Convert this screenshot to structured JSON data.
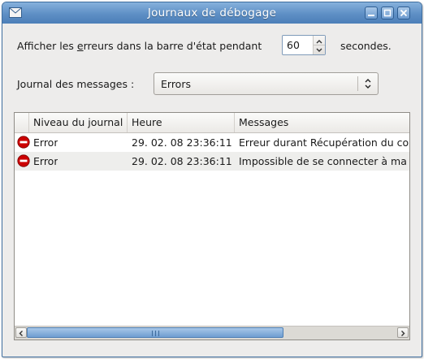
{
  "window": {
    "title": "Journaux de débogage",
    "icon": "envelope-icon"
  },
  "status_row": {
    "label_prefix": "Afficher les ",
    "label_mnemonic": "e",
    "label_suffix": "rreurs dans la barre d'état pendant",
    "seconds_value": "60",
    "unit_label": "secondes."
  },
  "filter": {
    "label": "Journal des messages :",
    "selected": "Errors"
  },
  "log_table": {
    "columns": [
      "Niveau du journal",
      "Heure",
      "Messages"
    ],
    "rows": [
      {
        "level": "Error",
        "time": "29. 02. 08 23:36:11",
        "message": "Erreur durant Récupération du co",
        "icon": "error-icon"
      },
      {
        "level": "Error",
        "time": "29. 02. 08 23:36:11",
        "message": "Impossible de se connecter à ma",
        "icon": "error-icon"
      }
    ]
  },
  "colors": {
    "titlebar": "#5e8fc5",
    "error_red": "#cc0000",
    "scroll_thumb": "#6f9dd1"
  }
}
